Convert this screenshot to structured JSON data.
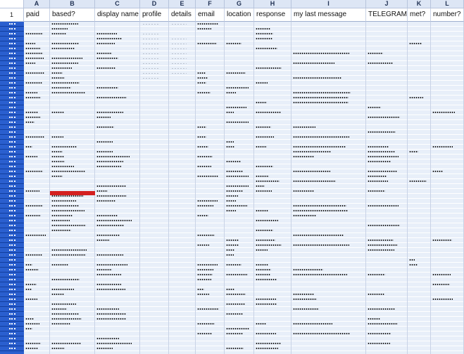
{
  "sheet": {
    "row1_number": "1",
    "columns": [
      {
        "letter": "A",
        "header": "paid"
      },
      {
        "letter": "B",
        "header": "based?"
      },
      {
        "letter": "C",
        "header": "display name"
      },
      {
        "letter": "D",
        "header": "profile"
      },
      {
        "letter": "E",
        "header": "details"
      },
      {
        "letter": "F",
        "header": "email"
      },
      {
        "letter": "G",
        "header": "location"
      },
      {
        "letter": "H",
        "header": "response"
      },
      {
        "letter": "I",
        "header": "my last message"
      },
      {
        "letter": "J",
        "header": "TELEGRAM"
      },
      {
        "letter": "K",
        "header": "met?"
      },
      {
        "letter": "L",
        "header": "number?"
      }
    ],
    "highlight_color": "#d42020",
    "selection_color": "#2a5fcf"
  }
}
